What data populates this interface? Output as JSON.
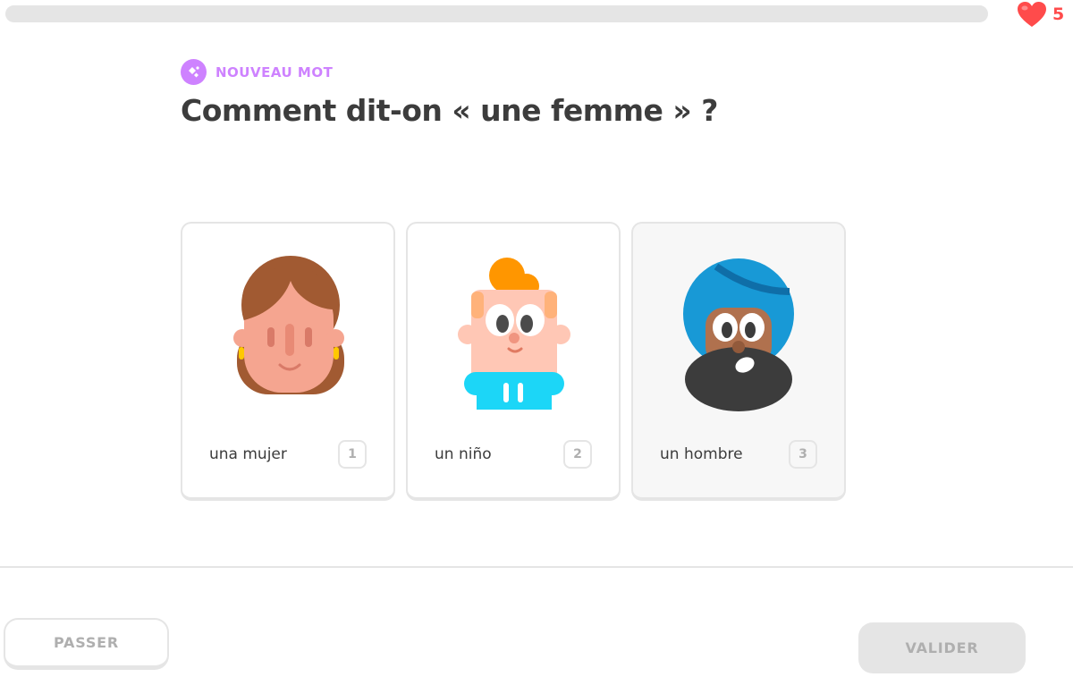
{
  "progress": {
    "fraction": 0.0
  },
  "hearts": {
    "count": "5",
    "icon": "heart-icon",
    "color": "#ff4b4b"
  },
  "challenge": {
    "tag_label": "NOUVEAU MOT",
    "tag_icon": "new-word-icon",
    "question": "Comment dit-on « une femme » ?"
  },
  "options": [
    {
      "label": "una mujer",
      "key": "1",
      "image": "woman-illustration"
    },
    {
      "label": "un niño",
      "key": "2",
      "image": "boy-illustration"
    },
    {
      "label": "un hombre",
      "key": "3",
      "image": "man-illustration"
    }
  ],
  "footer": {
    "skip_label": "PASSER",
    "check_label": "VALIDER"
  },
  "colors": {
    "accent_purple": "#ce82ff",
    "heart_red": "#ff4b4b",
    "border_gray": "#e5e5e5",
    "disabled_text": "#afafaf"
  }
}
